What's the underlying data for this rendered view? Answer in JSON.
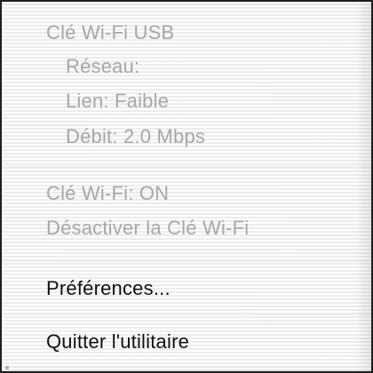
{
  "menu": {
    "status_section": {
      "header": "Clé Wi-Fi USB",
      "network": "Réseau:",
      "link": "Lien: Faible",
      "speed": "Débit: 2.0 Mbps"
    },
    "power_section": {
      "status": "Clé Wi-Fi: ON",
      "disable_action": "Désactiver la Clé Wi-Fi"
    },
    "preferences": "Préférences...",
    "quit": "Quitter l'utilitaire"
  },
  "colors": {
    "disabled_text": "#a7a7a7",
    "enabled_text": "#111111",
    "border": "#1f1f1f"
  }
}
